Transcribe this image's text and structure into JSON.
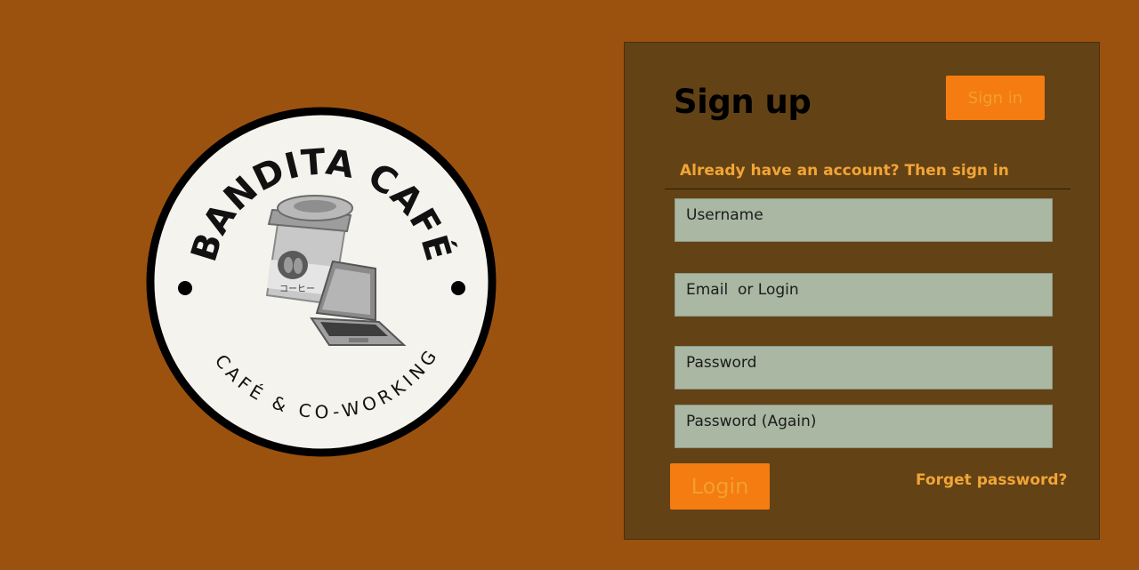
{
  "logo": {
    "name": "BANDITA CAFÉ",
    "tagline": "CAFÉ & CO-WORKING",
    "cup_text": "コーヒー",
    "icons": [
      "coffee-cup-icon",
      "laptop-icon"
    ]
  },
  "form": {
    "title": "Sign up",
    "signin_label": "Sign in",
    "subtitle": "Already have an account? Then sign in",
    "fields": [
      {
        "placeholder": "Username"
      },
      {
        "placeholder": "Email  or Login"
      },
      {
        "placeholder": "Password"
      },
      {
        "placeholder": "Password (Again)"
      }
    ],
    "login_label": "Login",
    "forgot_label": "Forget password?"
  },
  "colors": {
    "page_bg": "#9c520f",
    "panel_bg": "#634215",
    "accent_button": "#f47c10",
    "accent_text": "#f2a536",
    "field_bg": "#a9b7a3"
  }
}
